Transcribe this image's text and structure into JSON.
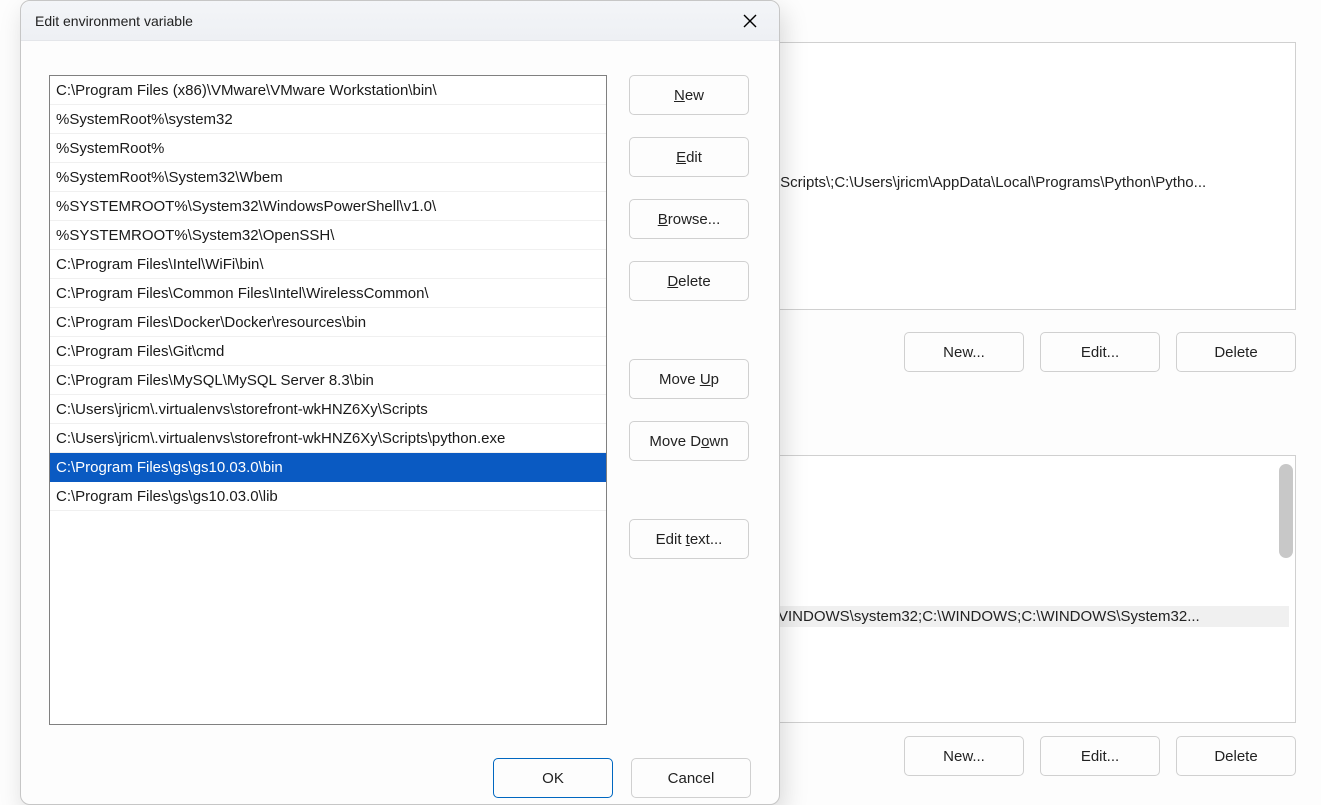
{
  "modal": {
    "title": "Edit environment variable",
    "buttons": {
      "new": "New",
      "edit": "Edit",
      "browse": "Browse...",
      "delete": "Delete",
      "moveup_pre": "Move ",
      "moveup_u": "U",
      "moveup_post": "p",
      "movedown_pre": "Move D",
      "movedown_u": "o",
      "movedown_post": "wn",
      "edittext_pre": "Edit ",
      "edittext_u": "t",
      "edittext_post": "ext...",
      "ok": "OK",
      "cancel": "Cancel"
    },
    "paths": [
      "C:\\Program Files (x86)\\VMware\\VMware Workstation\\bin\\",
      "%SystemRoot%\\system32",
      "%SystemRoot%",
      "%SystemRoot%\\System32\\Wbem",
      "%SYSTEMROOT%\\System32\\WindowsPowerShell\\v1.0\\",
      "%SYSTEMROOT%\\System32\\OpenSSH\\",
      "C:\\Program Files\\Intel\\WiFi\\bin\\",
      "C:\\Program Files\\Common Files\\Intel\\WirelessCommon\\",
      "C:\\Program Files\\Docker\\Docker\\resources\\bin",
      "C:\\Program Files\\Git\\cmd",
      "C:\\Program Files\\MySQL\\MySQL Server 8.3\\bin",
      "C:\\Users\\jricm\\.virtualenvs\\storefront-wkHNZ6Xy\\Scripts",
      "C:\\Users\\jricm\\.virtualenvs\\storefront-wkHNZ6Xy\\Scripts\\python.exe",
      "C:\\Program Files\\gs\\gs10.03.0\\bin",
      "C:\\Program Files\\gs\\gs10.03.0\\lib"
    ],
    "selected_index": 13
  },
  "background": {
    "row1_value": "\\Scripts\\;C:\\Users\\jricm\\AppData\\Local\\Programs\\Python\\Pytho...",
    "row2_value": "VINDOWS\\system32;C:\\WINDOWS;C:\\WINDOWS\\System32...",
    "buttons": {
      "new": "New...",
      "edit": "Edit...",
      "delete": "Delete"
    }
  }
}
